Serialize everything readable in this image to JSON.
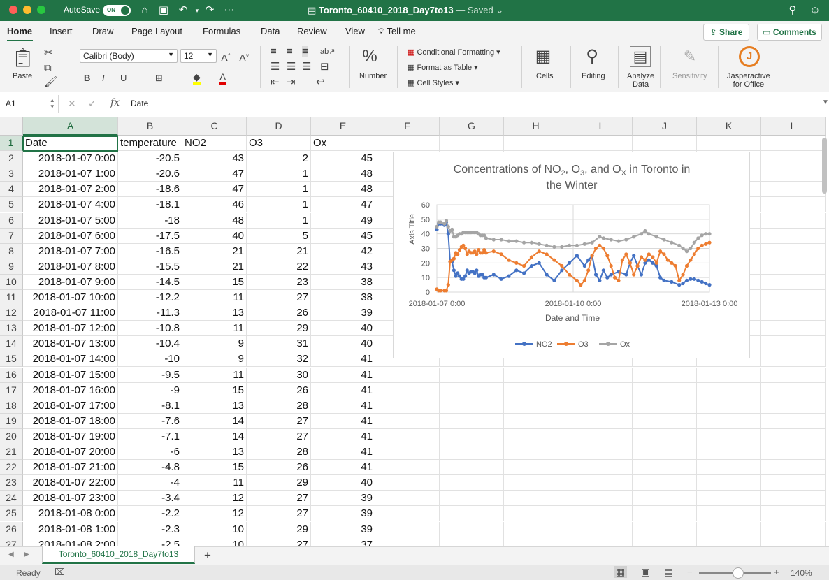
{
  "titlebar": {
    "autosave": "AutoSave",
    "toggle": "ON",
    "doc_title": "Toronto_60410_2018_Day7to13",
    "saved": " — Saved"
  },
  "ribbon_tabs": [
    "Home",
    "Insert",
    "Draw",
    "Page Layout",
    "Formulas",
    "Data",
    "Review",
    "View"
  ],
  "tell_me": "Tell me",
  "share": "Share",
  "comments": "Comments",
  "ribbon": {
    "paste": "Paste",
    "font_name": "Calibri (Body)",
    "font_size": "12",
    "bold": "B",
    "italic": "I",
    "underline": "U",
    "cond_format": "Conditional Formatting",
    "format_table": "Format as Table",
    "cell_styles": "Cell Styles",
    "number": "Number",
    "cells": "Cells",
    "editing": "Editing",
    "analyze": "Analyze\nData",
    "sensitivity": "Sensitivity",
    "jasper": "Jasperactive\nfor Office"
  },
  "formula_bar": {
    "name_box": "A1",
    "value": "Date"
  },
  "columns": [
    "A",
    "B",
    "C",
    "D",
    "E",
    "F",
    "G",
    "H",
    "I",
    "J",
    "K",
    "L"
  ],
  "headers": [
    "Date",
    "temperature",
    "NO2",
    "O3",
    "Ox"
  ],
  "rows": [
    [
      "2018-01-07 0:00",
      "-20.5",
      "43",
      "2",
      "45"
    ],
    [
      "2018-01-07 1:00",
      "-20.6",
      "47",
      "1",
      "48"
    ],
    [
      "2018-01-07 2:00",
      "-18.6",
      "47",
      "1",
      "48"
    ],
    [
      "2018-01-07 4:00",
      "-18.1",
      "46",
      "1",
      "47"
    ],
    [
      "2018-01-07 5:00",
      "-18",
      "48",
      "1",
      "49"
    ],
    [
      "2018-01-07 6:00",
      "-17.5",
      "40",
      "5",
      "45"
    ],
    [
      "2018-01-07 7:00",
      "-16.5",
      "21",
      "21",
      "42"
    ],
    [
      "2018-01-07 8:00",
      "-15.5",
      "21",
      "22",
      "43"
    ],
    [
      "2018-01-07 9:00",
      "-14.5",
      "15",
      "23",
      "38"
    ],
    [
      "2018-01-07 10:00",
      "-12.2",
      "11",
      "27",
      "38"
    ],
    [
      "2018-01-07 11:00",
      "-11.3",
      "13",
      "26",
      "39"
    ],
    [
      "2018-01-07 12:00",
      "-10.8",
      "11",
      "29",
      "40"
    ],
    [
      "2018-01-07 13:00",
      "-10.4",
      "9",
      "31",
      "40"
    ],
    [
      "2018-01-07 14:00",
      "-10",
      "9",
      "32",
      "41"
    ],
    [
      "2018-01-07 15:00",
      "-9.5",
      "11",
      "30",
      "41"
    ],
    [
      "2018-01-07 16:00",
      "-9",
      "15",
      "26",
      "41"
    ],
    [
      "2018-01-07 17:00",
      "-8.1",
      "13",
      "28",
      "41"
    ],
    [
      "2018-01-07 18:00",
      "-7.6",
      "14",
      "27",
      "41"
    ],
    [
      "2018-01-07 19:00",
      "-7.1",
      "14",
      "27",
      "41"
    ],
    [
      "2018-01-07 20:00",
      "-6",
      "13",
      "28",
      "41"
    ],
    [
      "2018-01-07 21:00",
      "-4.8",
      "15",
      "26",
      "41"
    ],
    [
      "2018-01-07 22:00",
      "-4",
      "11",
      "29",
      "40"
    ],
    [
      "2018-01-07 23:00",
      "-3.4",
      "12",
      "27",
      "39"
    ],
    [
      "2018-01-08 0:00",
      "-2.2",
      "12",
      "27",
      "39"
    ],
    [
      "2018-01-08 1:00",
      "-2.3",
      "10",
      "29",
      "39"
    ],
    [
      "2018-01-08 2:00",
      "-2.5",
      "10",
      "27",
      "37"
    ]
  ],
  "sheet_tab": "Toronto_60410_2018_Day7to13",
  "add_sheet": "+",
  "status": {
    "ready": "Ready",
    "zoom": "140%"
  },
  "chart_data": {
    "type": "line",
    "title_parts": [
      "Concentrations of NO",
      "2",
      ", O",
      "3",
      ", and O",
      "X",
      " in Toronto in"
    ],
    "title_line2": "the Winter",
    "xlabel": "Date and Time",
    "ylabel": "Axis Title",
    "ylim": [
      0,
      60
    ],
    "yticks": [
      "0",
      "10",
      "20",
      "30",
      "40",
      "50",
      "60"
    ],
    "xticks": [
      "2018-01-07 0:00",
      "2018-01-10 0:00",
      "2018-01-13 0:00"
    ],
    "x_range_hours": [
      0,
      144
    ],
    "legend_position": "bottom",
    "series": [
      {
        "name": "NO2",
        "color": "#4472c4",
        "values": [
          [
            0,
            43
          ],
          [
            1,
            47
          ],
          [
            2,
            47
          ],
          [
            4,
            46
          ],
          [
            5,
            48
          ],
          [
            6,
            40
          ],
          [
            7,
            21
          ],
          [
            8,
            21
          ],
          [
            9,
            15
          ],
          [
            10,
            11
          ],
          [
            11,
            13
          ],
          [
            12,
            11
          ],
          [
            13,
            9
          ],
          [
            14,
            9
          ],
          [
            15,
            11
          ],
          [
            16,
            15
          ],
          [
            17,
            13
          ],
          [
            18,
            14
          ],
          [
            19,
            14
          ],
          [
            20,
            13
          ],
          [
            21,
            15
          ],
          [
            22,
            11
          ],
          [
            23,
            12
          ],
          [
            24,
            12
          ],
          [
            25,
            10
          ],
          [
            26,
            10
          ],
          [
            30,
            12
          ],
          [
            34,
            9
          ],
          [
            38,
            11
          ],
          [
            42,
            15
          ],
          [
            46,
            13
          ],
          [
            50,
            18
          ],
          [
            54,
            20
          ],
          [
            58,
            12
          ],
          [
            62,
            8
          ],
          [
            66,
            15
          ],
          [
            70,
            20
          ],
          [
            74,
            25
          ],
          [
            78,
            18
          ],
          [
            80,
            22
          ],
          [
            82,
            25
          ],
          [
            84,
            12
          ],
          [
            86,
            8
          ],
          [
            88,
            15
          ],
          [
            90,
            10
          ],
          [
            92,
            12
          ],
          [
            96,
            14
          ],
          [
            100,
            12
          ],
          [
            102,
            20
          ],
          [
            104,
            25
          ],
          [
            106,
            18
          ],
          [
            108,
            12
          ],
          [
            110,
            20
          ],
          [
            112,
            22
          ],
          [
            114,
            20
          ],
          [
            116,
            18
          ],
          [
            118,
            10
          ],
          [
            120,
            8
          ],
          [
            124,
            7
          ],
          [
            128,
            5
          ],
          [
            130,
            6
          ],
          [
            132,
            8
          ],
          [
            134,
            9
          ],
          [
            136,
            9
          ],
          [
            138,
            8
          ],
          [
            140,
            7
          ],
          [
            142,
            6
          ],
          [
            144,
            5
          ]
        ]
      },
      {
        "name": "O3",
        "color": "#ed7d31",
        "values": [
          [
            0,
            2
          ],
          [
            1,
            1
          ],
          [
            2,
            1
          ],
          [
            4,
            1
          ],
          [
            5,
            1
          ],
          [
            6,
            5
          ],
          [
            7,
            21
          ],
          [
            8,
            22
          ],
          [
            9,
            23
          ],
          [
            10,
            27
          ],
          [
            11,
            26
          ],
          [
            12,
            29
          ],
          [
            13,
            31
          ],
          [
            14,
            32
          ],
          [
            15,
            30
          ],
          [
            16,
            26
          ],
          [
            17,
            28
          ],
          [
            18,
            27
          ],
          [
            19,
            27
          ],
          [
            20,
            28
          ],
          [
            21,
            26
          ],
          [
            22,
            29
          ],
          [
            23,
            27
          ],
          [
            24,
            27
          ],
          [
            25,
            29
          ],
          [
            26,
            27
          ],
          [
            30,
            28
          ],
          [
            34,
            26
          ],
          [
            38,
            22
          ],
          [
            42,
            20
          ],
          [
            46,
            18
          ],
          [
            50,
            24
          ],
          [
            54,
            28
          ],
          [
            58,
            26
          ],
          [
            62,
            22
          ],
          [
            66,
            18
          ],
          [
            70,
            12
          ],
          [
            74,
            8
          ],
          [
            76,
            5
          ],
          [
            78,
            8
          ],
          [
            80,
            15
          ],
          [
            82,
            25
          ],
          [
            84,
            30
          ],
          [
            86,
            32
          ],
          [
            88,
            30
          ],
          [
            90,
            25
          ],
          [
            92,
            18
          ],
          [
            94,
            10
          ],
          [
            96,
            8
          ],
          [
            98,
            22
          ],
          [
            100,
            26
          ],
          [
            102,
            20
          ],
          [
            104,
            12
          ],
          [
            106,
            18
          ],
          [
            108,
            24
          ],
          [
            110,
            22
          ],
          [
            112,
            26
          ],
          [
            114,
            24
          ],
          [
            116,
            20
          ],
          [
            118,
            28
          ],
          [
            120,
            26
          ],
          [
            122,
            22
          ],
          [
            124,
            20
          ],
          [
            126,
            18
          ],
          [
            128,
            8
          ],
          [
            130,
            12
          ],
          [
            132,
            18
          ],
          [
            134,
            22
          ],
          [
            136,
            26
          ],
          [
            138,
            30
          ],
          [
            140,
            32
          ],
          [
            142,
            33
          ],
          [
            144,
            34
          ]
        ]
      },
      {
        "name": "Ox",
        "color": "#a5a5a5",
        "values": [
          [
            0,
            45
          ],
          [
            1,
            48
          ],
          [
            2,
            48
          ],
          [
            4,
            47
          ],
          [
            5,
            49
          ],
          [
            6,
            45
          ],
          [
            7,
            42
          ],
          [
            8,
            43
          ],
          [
            9,
            38
          ],
          [
            10,
            38
          ],
          [
            11,
            39
          ],
          [
            12,
            40
          ],
          [
            13,
            40
          ],
          [
            14,
            41
          ],
          [
            15,
            41
          ],
          [
            16,
            41
          ],
          [
            17,
            41
          ],
          [
            18,
            41
          ],
          [
            19,
            41
          ],
          [
            20,
            41
          ],
          [
            21,
            41
          ],
          [
            22,
            40
          ],
          [
            23,
            39
          ],
          [
            24,
            39
          ],
          [
            25,
            39
          ],
          [
            26,
            37
          ],
          [
            30,
            36
          ],
          [
            34,
            36
          ],
          [
            38,
            35
          ],
          [
            42,
            35
          ],
          [
            46,
            34
          ],
          [
            50,
            34
          ],
          [
            54,
            33
          ],
          [
            58,
            32
          ],
          [
            62,
            31
          ],
          [
            66,
            31
          ],
          [
            70,
            32
          ],
          [
            74,
            32
          ],
          [
            78,
            33
          ],
          [
            82,
            34
          ],
          [
            86,
            38
          ],
          [
            88,
            37
          ],
          [
            92,
            36
          ],
          [
            96,
            35
          ],
          [
            100,
            36
          ],
          [
            104,
            38
          ],
          [
            108,
            40
          ],
          [
            110,
            42
          ],
          [
            112,
            40
          ],
          [
            116,
            38
          ],
          [
            120,
            36
          ],
          [
            124,
            34
          ],
          [
            128,
            32
          ],
          [
            130,
            30
          ],
          [
            132,
            28
          ],
          [
            134,
            30
          ],
          [
            136,
            34
          ],
          [
            138,
            37
          ],
          [
            140,
            39
          ],
          [
            142,
            40
          ],
          [
            144,
            40
          ]
        ]
      }
    ]
  }
}
